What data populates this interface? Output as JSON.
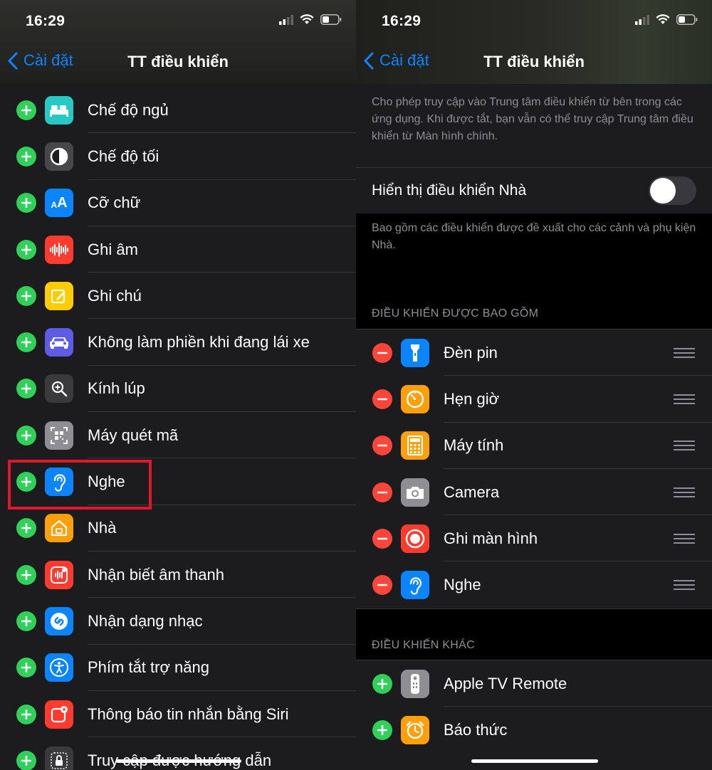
{
  "left": {
    "status_time": "16:29",
    "back_label": "Cài đặt",
    "title": "TT điều khiển",
    "items": [
      {
        "label": "Chế độ ngủ",
        "icon": "bed-icon",
        "color": "#27c9c4"
      },
      {
        "label": "Chế độ tối",
        "icon": "dark-mode-icon",
        "color": "#48484a"
      },
      {
        "label": "Cỡ chữ",
        "icon": "text-size-icon",
        "color": "#0a84ff"
      },
      {
        "label": "Ghi âm",
        "icon": "waveform-icon",
        "color": "#ff3b30"
      },
      {
        "label": "Ghi chú",
        "icon": "note-icon",
        "color": "#ffcc00"
      },
      {
        "label": "Không làm phiền khi đang lái xe",
        "icon": "car-icon",
        "color": "#5e5ce6"
      },
      {
        "label": "Kính lúp",
        "icon": "magnifier-icon",
        "color": "#3a3a3c"
      },
      {
        "label": "Máy quét mã",
        "icon": "qr-code-icon",
        "color": "#8e8e93"
      },
      {
        "label": "Nghe",
        "icon": "ear-icon",
        "color": "#0a84ff"
      },
      {
        "label": "Nhà",
        "icon": "home-icon",
        "color": "#ff9f0a"
      },
      {
        "label": "Nhận biết âm thanh",
        "icon": "sound-recognition-icon",
        "color": "#ff3b30"
      },
      {
        "label": "Nhận dạng nhạc",
        "icon": "shazam-icon",
        "color": "#0a84ff"
      },
      {
        "label": "Phím tắt trợ năng",
        "icon": "accessibility-icon",
        "color": "#0a84ff"
      },
      {
        "label": "Thông báo tin nhắn bằng Siri",
        "icon": "siri-message-icon",
        "color": "#ff3b30"
      },
      {
        "label": "Truy cập được hướng dẫn",
        "icon": "lock-icon",
        "color": "#3a3a3c"
      }
    ]
  },
  "right": {
    "status_time": "16:29",
    "back_label": "Cài đặt",
    "title": "TT điều khiển",
    "intro_text": "Cho phép truy cập vào Trung tâm điều khiển từ bên trong các ứng dụng. Khi được tắt, bạn vẫn có thể truy cập Trung tâm điều khiển từ Màn hình chính.",
    "home_toggle": {
      "label": "Hiển thị điều khiển Nhà",
      "on": false
    },
    "home_desc": "Bao gồm các điều khiển được đề xuất cho các cảnh và phụ kiện Nhà.",
    "included_header": "ĐIỀU KHIỂN ĐƯỢC BAO GỒM",
    "included": [
      {
        "label": "Đèn pin",
        "icon": "flashlight-icon",
        "color": "#0a84ff"
      },
      {
        "label": "Hẹn giờ",
        "icon": "timer-icon",
        "color": "#ff9f0a"
      },
      {
        "label": "Máy tính",
        "icon": "calculator-icon",
        "color": "#ff9f0a"
      },
      {
        "label": "Camera",
        "icon": "camera-icon",
        "color": "#8e8e93"
      },
      {
        "label": "Ghi màn hình",
        "icon": "screen-record-icon",
        "color": "#ff3b30"
      },
      {
        "label": "Nghe",
        "icon": "ear-icon",
        "color": "#0a84ff"
      }
    ],
    "more_header": "ĐIỀU KHIỂN KHÁC",
    "more": [
      {
        "label": "Apple TV Remote",
        "icon": "tv-remote-icon",
        "color": "#8e8e93"
      },
      {
        "label": "Báo thức",
        "icon": "alarm-icon",
        "color": "#ff9f0a"
      }
    ]
  }
}
